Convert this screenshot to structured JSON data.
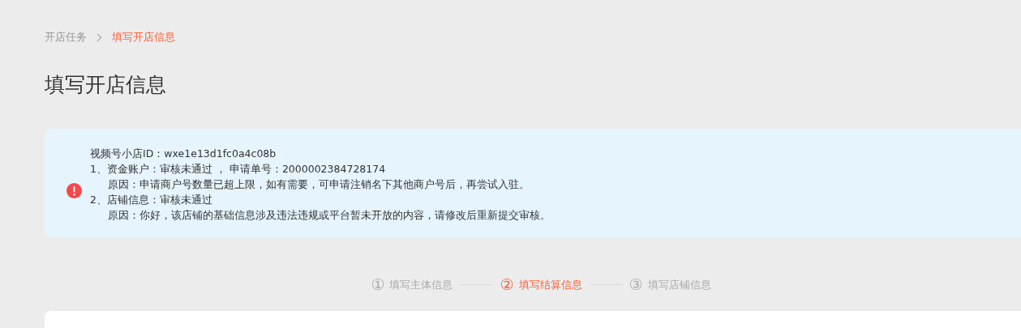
{
  "breadcrumb": [
    {
      "label": "开店任务",
      "selected": false
    },
    {
      "label": "填写开店信息",
      "selected": true
    }
  ],
  "title": "填写开店信息",
  "alert": {
    "lines": [
      {
        "text": "视频号小店ID：wxe1e13d1fc0a4c08b",
        "indent": false
      },
      {
        "text": "1、资金账户：审核未通过 ， 申请单号：2000002384728174",
        "indent": false
      },
      {
        "text": "原因：申请商户号数量已超上限，如有需要，可申请注销名下其他商户号后，再尝试入驻。",
        "indent": true
      },
      {
        "text": "2、店铺信息：审核未通过",
        "indent": false
      },
      {
        "text": "原因：你好，该店铺的基础信息涉及违法违规或平台暂未开放的内容，请修改后重新提交审核。",
        "indent": true
      }
    ]
  },
  "steps": [
    {
      "number": "①",
      "label": "填写主体信息",
      "selected": false
    },
    {
      "number": "②",
      "label": "填写结算信息",
      "selected": true
    },
    {
      "number": "③",
      "label": "填写店铺信息",
      "selected": false
    }
  ]
}
